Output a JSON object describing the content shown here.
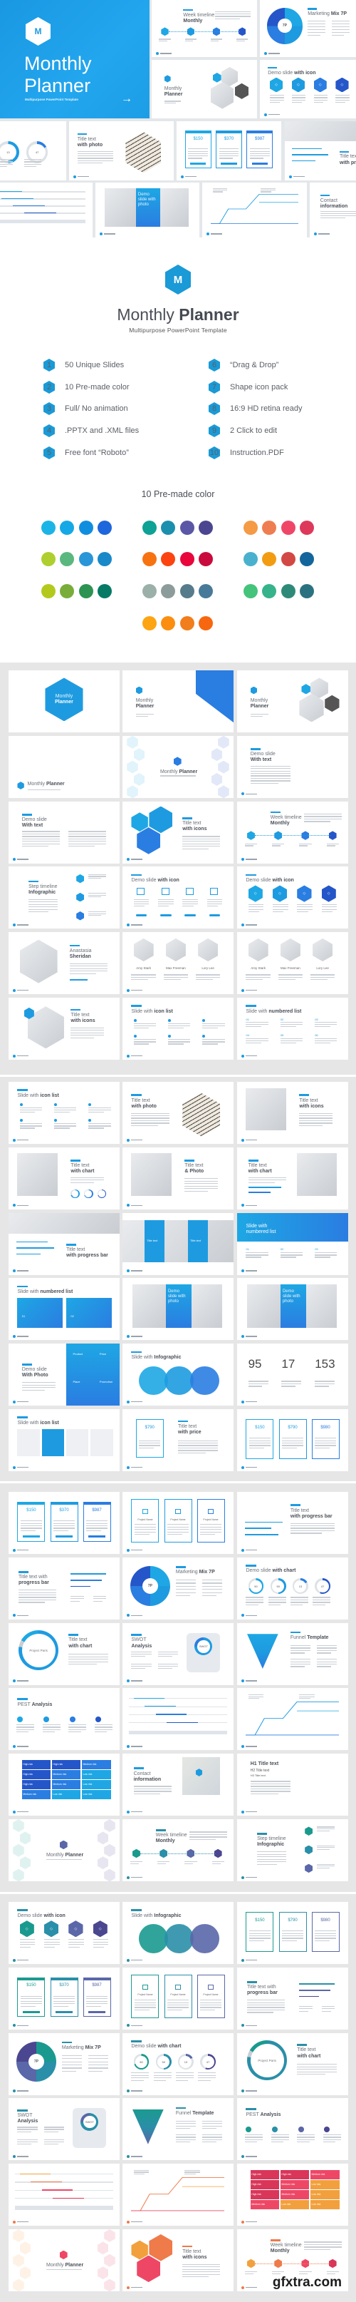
{
  "hero": {
    "logo_letter": "M",
    "title_light": "Monthly",
    "title_bold": "Planner",
    "subtitle": "Multipurpose PowerPoint Template",
    "arrow_icon": "arrow-right-icon",
    "color": "#1e9be0"
  },
  "collage": [
    {
      "kind": "timeline",
      "t": "Week timeline",
      "b": "Monthly",
      "palette": "blue"
    },
    {
      "kind": "wheel",
      "t": "Marketing",
      "b": "Mix 7P",
      "labels": [
        "7P"
      ],
      "palette": "blue"
    },
    {
      "kind": "photo-hex",
      "t": "Monthly",
      "b": "Planner",
      "palette": "blue"
    },
    {
      "kind": "icons-hex",
      "t": "Demo slide",
      "b": "with icon",
      "palette": "blue"
    },
    {
      "kind": "chart-donuts",
      "t": "",
      "b": "th chart",
      "labels": [
        "50",
        "13",
        "47"
      ],
      "palette": "blue"
    },
    {
      "kind": "photo-cube",
      "t": "Title text",
      "b": "with photo",
      "palette": "blue"
    },
    {
      "kind": "prices-btn",
      "labels": [
        "$150",
        "$370",
        "$987"
      ],
      "palette": "blue"
    },
    {
      "kind": "photos-top",
      "t": "Title tex",
      "b": "with pro",
      "palette": "blue"
    },
    {
      "kind": "gantt",
      "palette": "blue"
    },
    {
      "kind": "photo-panel",
      "labels": [
        "Demo slide with photo"
      ],
      "palette": "blue"
    },
    {
      "kind": "linechart",
      "palette": "blue"
    },
    {
      "kind": "contact",
      "t": "Contact",
      "b": "information",
      "palette": "blue"
    }
  ],
  "header": {
    "logo_letter": "M",
    "title_light": "Monthly",
    "title_bold": "Planner",
    "subtitle": "Multipurpose PowerPoint Template",
    "accent": "#1a9ad6"
  },
  "features": [
    {
      "num": "1",
      "label": "50 Unique Slides"
    },
    {
      "num": "2",
      "label": "10 Pre-made color"
    },
    {
      "num": "3",
      "label": "Full/ No animation"
    },
    {
      "num": "4",
      "label": ".PPTX and .XML files"
    },
    {
      "num": "5",
      "label": "Free font “Roboto”"
    },
    {
      "num": "6",
      "label": "“Drag & Drop”"
    },
    {
      "num": "7",
      "label": "Shape icon pack"
    },
    {
      "num": "8",
      "label": "16:9 HD retina ready"
    },
    {
      "num": "9",
      "label": "2 Click to edit"
    },
    {
      "num": "10",
      "label": "Instruction.PDF"
    }
  ],
  "colors_title": "10 Pre-made color",
  "color_sets": [
    [
      "#1cb4e6",
      "#14a9e6",
      "#0f8ee0",
      "#1e66dc"
    ],
    [
      "#0ea196",
      "#1b8fad",
      "#5a57a6",
      "#4b468f"
    ],
    [
      "#f59a45",
      "#ee7e51",
      "#ef4668",
      "#dd395b"
    ],
    [
      "#aecf2f",
      "#5ab87e",
      "#2996d8",
      "#1a89c9"
    ],
    [
      "#f77211",
      "#fb4410",
      "#e8063a",
      "#c90a3c"
    ],
    [
      "#49b1cd",
      "#f29c12",
      "#d24845",
      "#13669b"
    ],
    [
      "#b4c91d",
      "#79ad3b",
      "#2d9350",
      "#067a65"
    ],
    [
      "#9ab0a9",
      "#8c9c9a",
      "#567b8b",
      "#477a98"
    ],
    [
      "#44c37a",
      "#36b38a",
      "#2e8a78",
      "#2b7281"
    ],
    [
      "#fda412",
      "#fb8e10",
      "#f17d1c",
      "#f7670f"
    ]
  ],
  "palettes": {
    "blue": [
      "#1ea7e4",
      "#1e9be0",
      "#2a7de1",
      "#2456c9"
    ],
    "teal": [
      "#1a9a8f",
      "#2a8fa8",
      "#5a67a8",
      "#4b4690"
    ],
    "red": [
      "#f2a03d",
      "#ef7a4a",
      "#ee4766",
      "#d9365a"
    ]
  },
  "sections": [
    {
      "slides": [
        {
          "kind": "cover-hex",
          "t": "Monthly",
          "b": "Planner",
          "palette": "blue"
        },
        {
          "kind": "cover-corner",
          "t": "Monthly",
          "b": "Planner",
          "palette": "blue"
        },
        {
          "kind": "photo-hex",
          "t": "Monthly",
          "b": "Planner",
          "palette": "blue"
        },
        {
          "kind": "cover-left",
          "t": "Monthly",
          "b": "Planner",
          "palette": "blue"
        },
        {
          "kind": "hexpattern",
          "t": "Monthly",
          "b": "Planner",
          "palette": "blue"
        },
        {
          "kind": "text",
          "t": "Demo slide",
          "b": "With text",
          "palette": "blue"
        },
        {
          "kind": "text2",
          "t": "Demo slide",
          "b": "With text",
          "palette": "blue"
        },
        {
          "kind": "hex-cluster",
          "t": "Title text",
          "b": "with icons",
          "palette": "blue"
        },
        {
          "kind": "timeline",
          "t": "Week timeline",
          "b": "Monthly",
          "palette": "blue"
        },
        {
          "kind": "steps",
          "t": "Step timeline",
          "b": "Infographic",
          "palette": "blue"
        },
        {
          "kind": "icons-outline",
          "t": "Demo slide",
          "b": "with icon",
          "palette": "blue"
        },
        {
          "kind": "icons-hex",
          "t": "Demo slide",
          "b": "with icon",
          "palette": "blue"
        },
        {
          "kind": "portrait",
          "t": "Anastasia",
          "b": "Sheridan",
          "palette": "blue"
        },
        {
          "kind": "team",
          "labels": [
            "Amy Stark",
            "Max Freeman",
            "Lory Lee"
          ],
          "palette": "blue"
        },
        {
          "kind": "team",
          "labels": [
            "Amy Stark",
            "Max Freeman",
            "Lory Lee"
          ],
          "palette": "blue"
        },
        {
          "kind": "photo-hex-left",
          "t": "Title text",
          "b": "with icons",
          "palette": "blue"
        },
        {
          "kind": "iconlist",
          "t": "Slide with",
          "b": "icon list",
          "palette": "blue"
        },
        {
          "kind": "numlist",
          "t": "Slide with",
          "b": "numbered list",
          "labels": [
            "01",
            "02",
            "03",
            "04",
            "05",
            "06"
          ],
          "palette": "blue"
        }
      ]
    },
    {
      "slides": [
        {
          "kind": "iconlist",
          "t": "Slide with",
          "b": "icon list",
          "palette": "blue"
        },
        {
          "kind": "photo-cube",
          "t": "Title text",
          "b": "with photo",
          "palette": "blue"
        },
        {
          "kind": "photo",
          "t": "Title text",
          "b": "with icons",
          "palette": "blue"
        },
        {
          "kind": "photo-donuts",
          "t": "Title text",
          "b": "with chart",
          "palette": "blue"
        },
        {
          "kind": "photo",
          "t": "Title text",
          "b": "& Photo",
          "palette": "blue"
        },
        {
          "kind": "photo-right",
          "t": "Title text",
          "b": "with chart",
          "palette": "blue"
        },
        {
          "kind": "photos-top",
          "t": "Title text",
          "b": "with progress bar",
          "palette": "blue"
        },
        {
          "kind": "blue-panels",
          "labels": [
            "Title text",
            "Title text"
          ],
          "palette": "blue"
        },
        {
          "kind": "banner",
          "t": "Slide with",
          "b": "numbered list",
          "labels": [
            "01",
            "02",
            "03"
          ],
          "palette": "blue"
        },
        {
          "kind": "blue-boxes",
          "t": "Slide with",
          "b": "numbered list",
          "labels": [
            "01",
            "02"
          ],
          "palette": "blue"
        },
        {
          "kind": "photo-panel",
          "labels": [
            "Demo slide with photo"
          ],
          "palette": "blue"
        },
        {
          "kind": "photo-panel",
          "labels": [
            "Demo slide with photo"
          ],
          "palette": "blue"
        },
        {
          "kind": "product",
          "t": "Demo slide",
          "b": "With Photo",
          "labels": [
            "Product",
            "Price",
            "Place",
            "Promotion"
          ],
          "palette": "blue"
        },
        {
          "kind": "circles",
          "t": "Slide with",
          "b": "Infographic",
          "palette": "blue"
        },
        {
          "kind": "stats",
          "labels": [
            "95",
            "17",
            "153"
          ],
          "palette": "blue"
        },
        {
          "kind": "tiles",
          "t": "Slide with",
          "b": "icon list",
          "palette": "blue"
        },
        {
          "kind": "price-single",
          "t": "Title text",
          "b": "with price",
          "labels": [
            "$790"
          ],
          "palette": "blue"
        },
        {
          "kind": "prices",
          "labels": [
            "$150",
            "$790",
            "$980"
          ],
          "palette": "blue"
        }
      ]
    },
    {
      "slides": [
        {
          "kind": "prices-btn",
          "labels": [
            "$150",
            "$370",
            "$987"
          ],
          "palette": "blue"
        },
        {
          "kind": "price-icons",
          "labels": [
            "Project Name",
            "Project Name",
            "Project Name"
          ],
          "palette": "blue"
        },
        {
          "kind": "progress",
          "t": "Title text",
          "b": "with progress bar",
          "palette": "blue"
        },
        {
          "kind": "progress2",
          "t": "Title text with",
          "b": "progress bar",
          "palette": "blue"
        },
        {
          "kind": "wheel",
          "t": "Marketing",
          "b": "Mix 7P",
          "labels": [
            "7P"
          ],
          "palette": "blue"
        },
        {
          "kind": "chart-donuts",
          "t": "Demo slide",
          "b": "with chart",
          "labels": [
            "50",
            "50",
            "13",
            "47"
          ],
          "palette": "blue"
        },
        {
          "kind": "donut-big",
          "t": "Title text",
          "b": "with chart",
          "labels": [
            "Project Paris"
          ],
          "palette": "blue"
        },
        {
          "kind": "swot",
          "t": "SWOT",
          "b": "Analysis",
          "labels": [
            "SWOT"
          ],
          "palette": "blue"
        },
        {
          "kind": "funnel",
          "t": "Funnel",
          "b": "Template",
          "palette": "blue"
        },
        {
          "kind": "pest",
          "t": "PEST",
          "b": "Analysis",
          "palette": "blue"
        },
        {
          "kind": "gantt",
          "palette": "blue"
        },
        {
          "kind": "linechart",
          "palette": "blue"
        },
        {
          "kind": "matrix",
          "labels": [
            "High risk",
            "High risk",
            "Medium risk",
            "High risk",
            "Medium risk",
            "Low risk",
            "High risk",
            "Medium risk",
            "Low risk",
            "Medium risk",
            "Low risk",
            "Low risk"
          ],
          "palette": "blue"
        },
        {
          "kind": "contact",
          "t": "Contact",
          "b": "information",
          "palette": "blue"
        },
        {
          "kind": "typography",
          "labels": [
            "H1 Title text",
            "H2 Title text",
            "H3 Title text"
          ],
          "palette": "blue"
        },
        {
          "kind": "hexpattern",
          "t": "Monthly",
          "b": "Planner",
          "palette": "teal"
        },
        {
          "kind": "timeline",
          "t": "Week timeline",
          "b": "Monthly",
          "palette": "teal"
        },
        {
          "kind": "steps",
          "t": "Step timeline",
          "b": "Infographic",
          "palette": "teal"
        }
      ]
    },
    {
      "slides": [
        {
          "kind": "icons-hex",
          "t": "Demo slide",
          "b": "with icon",
          "palette": "teal"
        },
        {
          "kind": "circles",
          "t": "Slide with",
          "b": "Infographic",
          "palette": "teal"
        },
        {
          "kind": "prices",
          "labels": [
            "$150",
            "$790",
            "$980"
          ],
          "palette": "teal"
        },
        {
          "kind": "prices-btn",
          "labels": [
            "$150",
            "$370",
            "$987"
          ],
          "palette": "teal"
        },
        {
          "kind": "price-icons",
          "labels": [
            "Project Name",
            "Project Name",
            "Project Name"
          ],
          "palette": "teal"
        },
        {
          "kind": "progress2",
          "t": "Title text with",
          "b": "progress bar",
          "palette": "teal"
        },
        {
          "kind": "wheel",
          "t": "Marketing",
          "b": "Mix 7P",
          "labels": [
            "7P"
          ],
          "palette": "teal"
        },
        {
          "kind": "chart-donuts",
          "t": "Demo slide",
          "b": "with chart",
          "labels": [
            "50",
            "50",
            "13",
            "47"
          ],
          "palette": "teal"
        },
        {
          "kind": "donut-big",
          "t": "Title text",
          "b": "with chart",
          "labels": [
            "Project Paris"
          ],
          "palette": "teal"
        },
        {
          "kind": "swot",
          "t": "SWOT",
          "b": "Analysis",
          "labels": [
            "SWOT"
          ],
          "palette": "teal"
        },
        {
          "kind": "funnel",
          "t": "Funnel",
          "b": "Template",
          "palette": "teal"
        },
        {
          "kind": "pest",
          "t": "PEST",
          "b": "Analysis",
          "palette": "teal"
        },
        {
          "kind": "gantt",
          "palette": "red"
        },
        {
          "kind": "linechart",
          "palette": "red"
        },
        {
          "kind": "matrix",
          "labels": [
            "High risk",
            "High risk",
            "Medium risk",
            "High risk",
            "Medium risk",
            "Low risk",
            "High risk",
            "Medium risk",
            "Low risk",
            "Medium risk",
            "Low risk",
            "Low risk"
          ],
          "palette": "red"
        },
        {
          "kind": "hexpattern",
          "t": "Monthly",
          "b": "Planner",
          "palette": "red"
        },
        {
          "kind": "hex-cluster",
          "t": "Title text",
          "b": "with icons",
          "palette": "red"
        },
        {
          "kind": "timeline",
          "t": "Week timeline",
          "b": "Monthly",
          "palette": "red"
        }
      ]
    }
  ],
  "watermark": "gfxtra.com"
}
